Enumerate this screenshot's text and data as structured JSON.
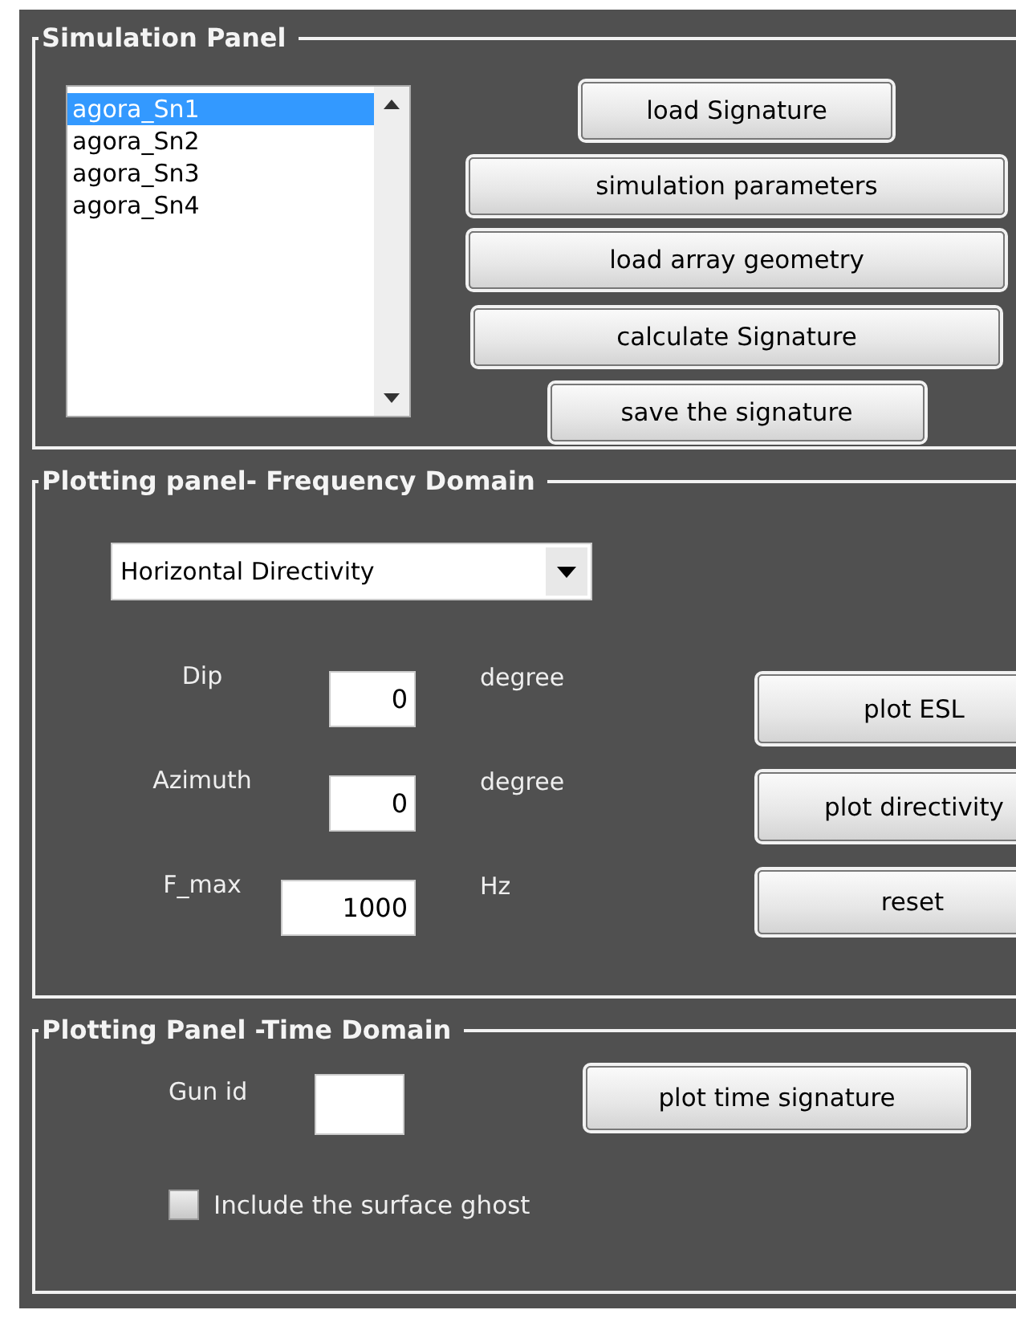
{
  "simulation_panel": {
    "title": "Simulation Panel",
    "signatures": [
      {
        "label": "agora_Sn1",
        "selected": true
      },
      {
        "label": "agora_Sn2",
        "selected": false
      },
      {
        "label": "agora_Sn3",
        "selected": false
      },
      {
        "label": "agora_Sn4",
        "selected": false
      }
    ],
    "buttons": [
      "load Signature",
      "simulation parameters",
      "load array geometry",
      "calculate Signature",
      "save the signature"
    ]
  },
  "frequency_panel": {
    "title": "Plotting panel- Frequency Domain",
    "plot_type": {
      "value": "Horizontal Directivity"
    },
    "fields": [
      {
        "label": "Dip",
        "value": "0",
        "unit": "degree"
      },
      {
        "label": "Azimuth",
        "value": "0",
        "unit": "degree"
      },
      {
        "label": "F_max",
        "value": "1000",
        "unit": "Hz"
      }
    ],
    "buttons": [
      "plot ESL",
      "plot directivity",
      "reset"
    ]
  },
  "time_panel": {
    "title": "Plotting Panel -Time Domain",
    "gun_id": {
      "label": "Gun id"
    },
    "button": "plot time signature",
    "surface_ghost": {
      "label": "Include the surface ghost",
      "checked": false
    }
  }
}
